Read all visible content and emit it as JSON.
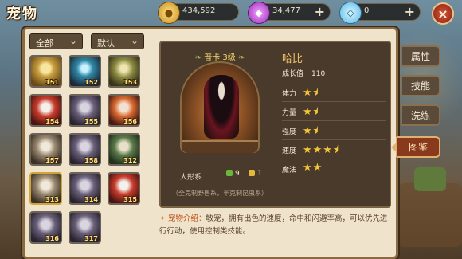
{
  "header": {
    "title": "宠物",
    "gold": "434,592",
    "gems": "34,477",
    "diamonds": "0",
    "plus": "+",
    "close": "×"
  },
  "filters": {
    "left": "全部",
    "right": "默认"
  },
  "pets": [
    {
      "num": "151",
      "style": "yellow",
      "selected": false
    },
    {
      "num": "152",
      "style": "blue",
      "selected": false
    },
    {
      "num": "153",
      "style": "olive",
      "selected": false
    },
    {
      "num": "154",
      "style": "red",
      "selected": false
    },
    {
      "num": "155",
      "style": "grey",
      "selected": false
    },
    {
      "num": "156",
      "style": "orange",
      "selected": false
    },
    {
      "num": "157",
      "style": "tan",
      "selected": false
    },
    {
      "num": "158",
      "style": "grey",
      "selected": false
    },
    {
      "num": "312",
      "style": "green",
      "selected": false
    },
    {
      "num": "313",
      "style": "tan",
      "selected": true
    },
    {
      "num": "314",
      "style": "grey",
      "selected": false
    },
    {
      "num": "315",
      "style": "red",
      "selected": false
    },
    {
      "num": "316",
      "style": "grey",
      "selected": false
    },
    {
      "num": "317",
      "style": "grey",
      "selected": false
    }
  ],
  "detail": {
    "rank": "普卡 3级",
    "name": "哈比",
    "growth_label": "成长值",
    "growth_value": "110",
    "race": "人形系",
    "green_count": "9",
    "yellow_count": "1",
    "restrain": "（全克制野兽系，半克制昆虫系）",
    "stats": [
      {
        "name": "体力",
        "stars": 1.5
      },
      {
        "name": "力量",
        "stars": 1.5
      },
      {
        "name": "强度",
        "stars": 1.5
      },
      {
        "name": "速度",
        "stars": 3.5
      },
      {
        "name": "魔法",
        "stars": 2
      }
    ]
  },
  "intro": {
    "label": "宠物介绍：",
    "text": "敏宠，拥有出色的速度，命中和闪避率高，可以优先进行行动，使用控制类技能。"
  },
  "tabs": [
    {
      "label": "属性",
      "active": false
    },
    {
      "label": "技能",
      "active": false
    },
    {
      "label": "洗练",
      "active": false
    },
    {
      "label": "图鉴",
      "active": true
    }
  ],
  "colors": {
    "accent": "#f2c46a",
    "star": "#f6c63a",
    "active_tab": "#8a3a1c"
  }
}
